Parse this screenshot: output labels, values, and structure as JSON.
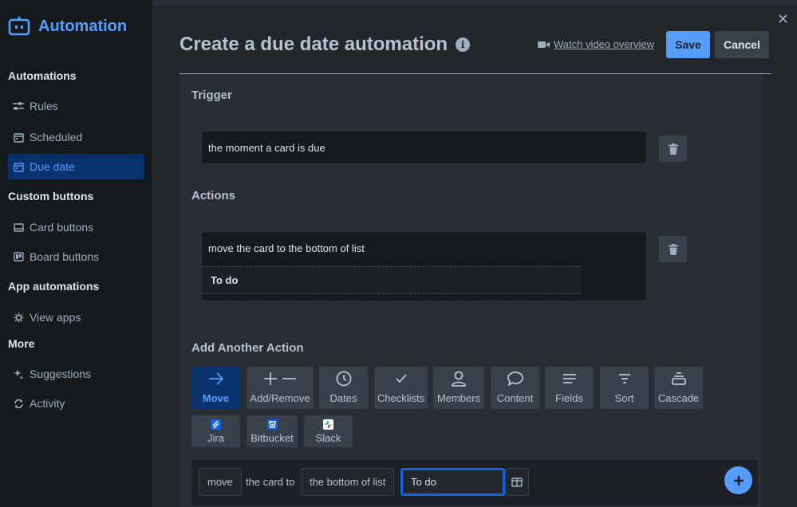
{
  "app": {
    "title": "Automation"
  },
  "sidebar": {
    "sections": [
      {
        "title": "Automations"
      },
      {
        "title": "Custom buttons"
      },
      {
        "title": "App automations"
      },
      {
        "title": "More"
      }
    ],
    "items": [
      {
        "label": "Rules",
        "icon": "sliders-icon"
      },
      {
        "label": "Scheduled",
        "icon": "calendar-icon"
      },
      {
        "label": "Due date",
        "icon": "calendar-icon",
        "active": true
      },
      {
        "label": "Card buttons",
        "icon": "card-icon"
      },
      {
        "label": "Board buttons",
        "icon": "board-icon"
      },
      {
        "label": "View apps",
        "icon": "gear-icon"
      },
      {
        "label": "Suggestions",
        "icon": "sparkle-icon"
      },
      {
        "label": "Activity",
        "icon": "refresh-icon"
      }
    ]
  },
  "header": {
    "title": "Create a due date automation",
    "info_glyph": "i",
    "video_link": "Watch video overview",
    "save_label": "Save",
    "cancel_label": "Cancel",
    "close_glyph": "✕"
  },
  "trigger": {
    "heading": "Trigger",
    "text": "the moment a card is due"
  },
  "actions": {
    "heading": "Actions",
    "text": "move the card to the bottom of list",
    "list_name": "To do"
  },
  "add_action": {
    "heading": "Add Another Action",
    "buttons": [
      {
        "label": "Move",
        "icon": "arrow-right-icon",
        "active": true
      },
      {
        "label": "Add/Remove",
        "icon": "plus-minus-icon"
      },
      {
        "label": "Dates",
        "icon": "clock-icon"
      },
      {
        "label": "Checklists",
        "icon": "check-icon"
      },
      {
        "label": "Members",
        "icon": "person-icon"
      },
      {
        "label": "Content",
        "icon": "comment-icon"
      },
      {
        "label": "Fields",
        "icon": "lines-icon"
      },
      {
        "label": "Sort",
        "icon": "sort-icon"
      },
      {
        "label": "Cascade",
        "icon": "cascade-icon"
      }
    ],
    "integrations": [
      {
        "label": "Jira",
        "icon": "jira-icon"
      },
      {
        "label": "Bitbucket",
        "icon": "bitbucket-icon"
      },
      {
        "label": "Slack",
        "icon": "slack-icon"
      }
    ]
  },
  "builder": {
    "verb": "move",
    "text1": "the card to",
    "position": "the bottom of list",
    "list_value": "To do"
  },
  "colors": {
    "accent": "#579dff",
    "active_bg": "#09326c",
    "focus_border": "#0c66e4"
  }
}
